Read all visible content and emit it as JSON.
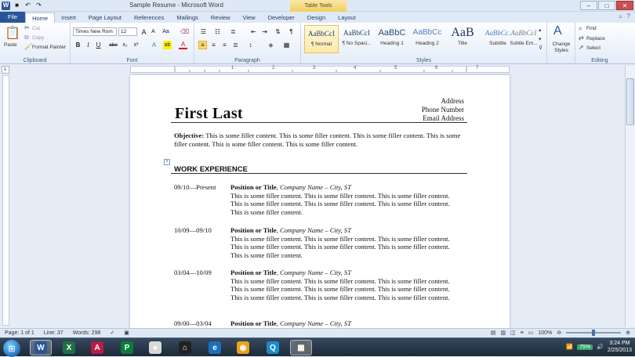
{
  "window": {
    "title": "Sample Resume - Microsoft Word",
    "context_tab": "Table Tools",
    "qat": {
      "undo": "↶",
      "redo": "↷",
      "save": "■"
    },
    "controls": {
      "minimize": "–",
      "maximize": "□",
      "close": "✕"
    }
  },
  "tabs": [
    "File",
    "Home",
    "Insert",
    "Page Layout",
    "References",
    "Mailings",
    "Review",
    "View",
    "Developer",
    "Design",
    "Layout"
  ],
  "ribbon": {
    "clipboard": {
      "paste": "Paste",
      "cut": "Cut",
      "copy": "Copy",
      "format_painter": "Format Painter",
      "label": "Clipboard"
    },
    "font": {
      "family": "Times New Rom",
      "size": "12",
      "label": "Font",
      "bold": "B",
      "italic": "I",
      "underline": "U",
      "strike": "abe",
      "subscript": "x₂",
      "superscript": "x²",
      "grow": "A",
      "shrink": "A",
      "clear": "Aa",
      "highlight": "ab",
      "color": "A"
    },
    "paragraph": {
      "label": "Paragraph",
      "pilcrow": "¶"
    },
    "styles": {
      "label": "Styles",
      "items": [
        {
          "sample": "AaBbCcI",
          "name": "¶ Normal"
        },
        {
          "sample": "AaBbCcI",
          "name": "¶ No Spaci..."
        },
        {
          "sample": "AaBbC",
          "name": "Heading 1"
        },
        {
          "sample": "AaBbCc",
          "name": "Heading 2"
        },
        {
          "sample": "AaB",
          "name": "Title"
        },
        {
          "sample": "AaBbCc.",
          "name": "Subtitle"
        },
        {
          "sample": "AaBbCcI",
          "name": "Subtle Em..."
        }
      ],
      "change": "Change Styles"
    },
    "editing": {
      "find": "Find",
      "replace": "Replace",
      "select": "Select",
      "label": "Editing"
    }
  },
  "ruler": {
    "marks": [
      "1",
      "2",
      "3",
      "4",
      "5",
      "6",
      "7"
    ]
  },
  "document": {
    "name": "First Last",
    "contact": [
      "Address",
      "Phone Number",
      "Email Address"
    ],
    "objective_label": "Objective:",
    "objective_text": "This is some filler content. This is some filler content. This is some filler content. This is some filler content. This is some filler content. This is some filler content.",
    "section_heading": "WORK EXPERIENCE",
    "jobs": [
      {
        "dates": "09/10—Present",
        "title": "Position or Title",
        "company": "Company Name – City, ST",
        "desc": "This is some filler content. This is some filler content. This is some filler content. This is some filler content. This is some filler content. This is some filler content. This is some filler content."
      },
      {
        "dates": "10/09—09/10",
        "title": "Position or Title",
        "company": "Company Name – City, ST",
        "desc": "This is some filler content. This is some filler content. This is some filler content. This is some filler content. This is some filler content. This is some filler content. This is some filler content."
      },
      {
        "dates": "03/04—10/09",
        "title": "Position or Title",
        "company": "Company Name – City, ST",
        "desc": "This is some filler content. This is some filler content. This is some filler content. This is some filler content. This is some filler content. This is some filler content. This is some filler content. This is some filler content. This is some filler content."
      },
      {
        "dates": "09/00—03/04",
        "title": "Position or Title",
        "company": "Company Name – City, ST",
        "desc": ""
      }
    ]
  },
  "status": {
    "page": "Page: 1 of 1",
    "line": "Line: 37",
    "words": "Words: 298",
    "zoom": "100%",
    "zoom_fraction": 0.5
  },
  "taskbar": {
    "apps": [
      {
        "label": "W",
        "color": "#2b5797",
        "active": true
      },
      {
        "label": "X",
        "color": "#1e7145",
        "active": false
      },
      {
        "label": "A",
        "color": "#b91d47",
        "active": false
      },
      {
        "label": "P",
        "color": "#0a7d3a",
        "active": false
      },
      {
        "label": "●",
        "color": "#d9d9d9",
        "active": false
      },
      {
        "label": "⌂",
        "color": "#222",
        "active": false
      },
      {
        "label": "e",
        "color": "#1c6fbf",
        "active": false
      },
      {
        "label": "◉",
        "color": "#e8a21b",
        "active": false
      },
      {
        "label": "Q",
        "color": "#1b8ad0",
        "active": false
      },
      {
        "label": "▦",
        "color": "#666",
        "active": true
      }
    ],
    "battery": "75%",
    "time": "3:24 PM",
    "date": "2/25/2013"
  }
}
